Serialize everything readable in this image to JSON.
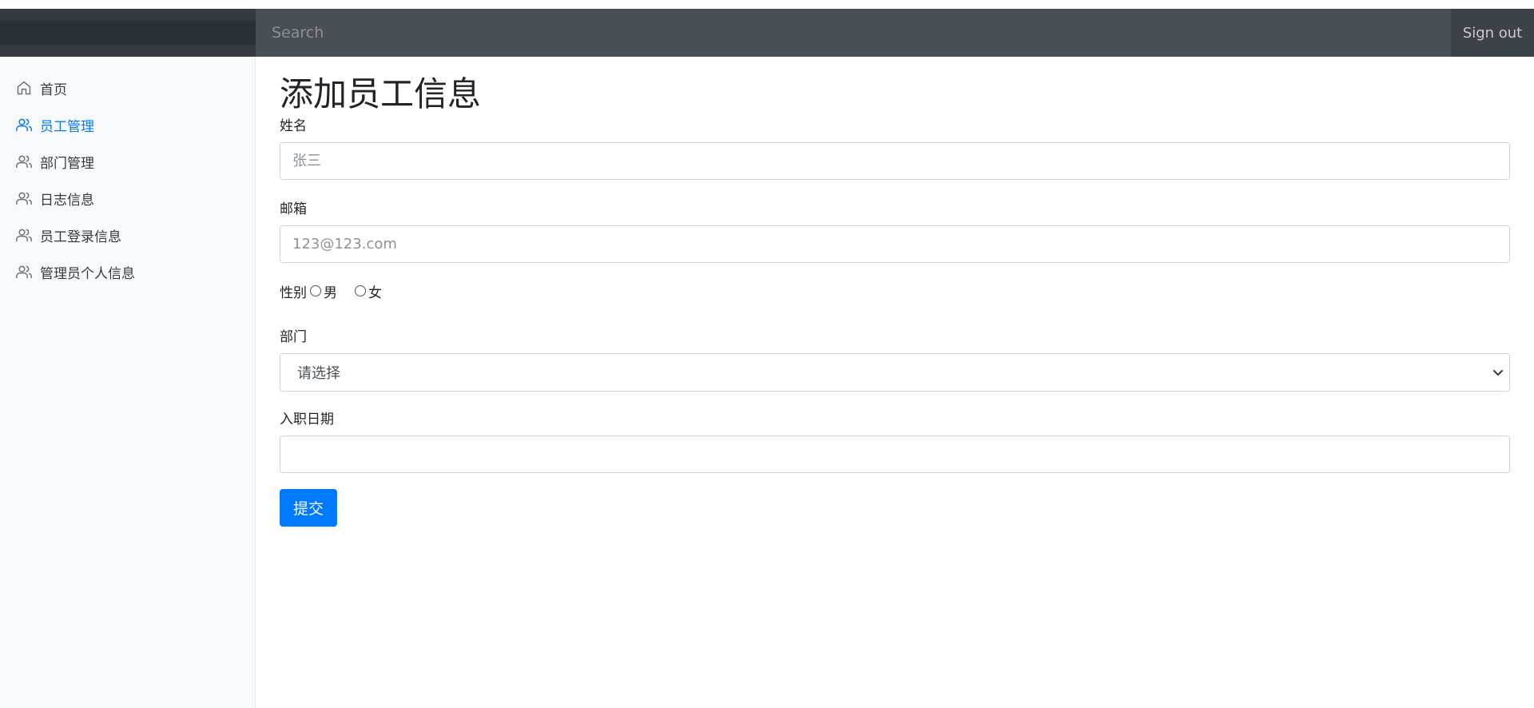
{
  "navbar": {
    "search_placeholder": "Search",
    "signout_label": "Sign out"
  },
  "sidebar": {
    "items": [
      {
        "label": "首页",
        "icon": "home-icon"
      },
      {
        "label": "员工管理",
        "icon": "users-icon",
        "active": true
      },
      {
        "label": "部门管理",
        "icon": "users-icon"
      },
      {
        "label": "日志信息",
        "icon": "users-icon"
      },
      {
        "label": "员工登录信息",
        "icon": "users-icon"
      },
      {
        "label": "管理员个人信息",
        "icon": "users-icon"
      }
    ]
  },
  "form": {
    "title": "添加员工信息",
    "name_label": "姓名",
    "name_placeholder": "张三",
    "email_label": "邮箱",
    "email_placeholder": "123@123.com",
    "gender_label": "性别",
    "gender_options": [
      "男",
      "女"
    ],
    "department_label": "部门",
    "department_selected": "请选择",
    "date_label": "入职日期",
    "date_value": "",
    "submit_label": "提交"
  },
  "colors": {
    "accent": "#007bff",
    "navbar": "#4a4f55",
    "sidebar_bg": "#f8f9fa"
  }
}
